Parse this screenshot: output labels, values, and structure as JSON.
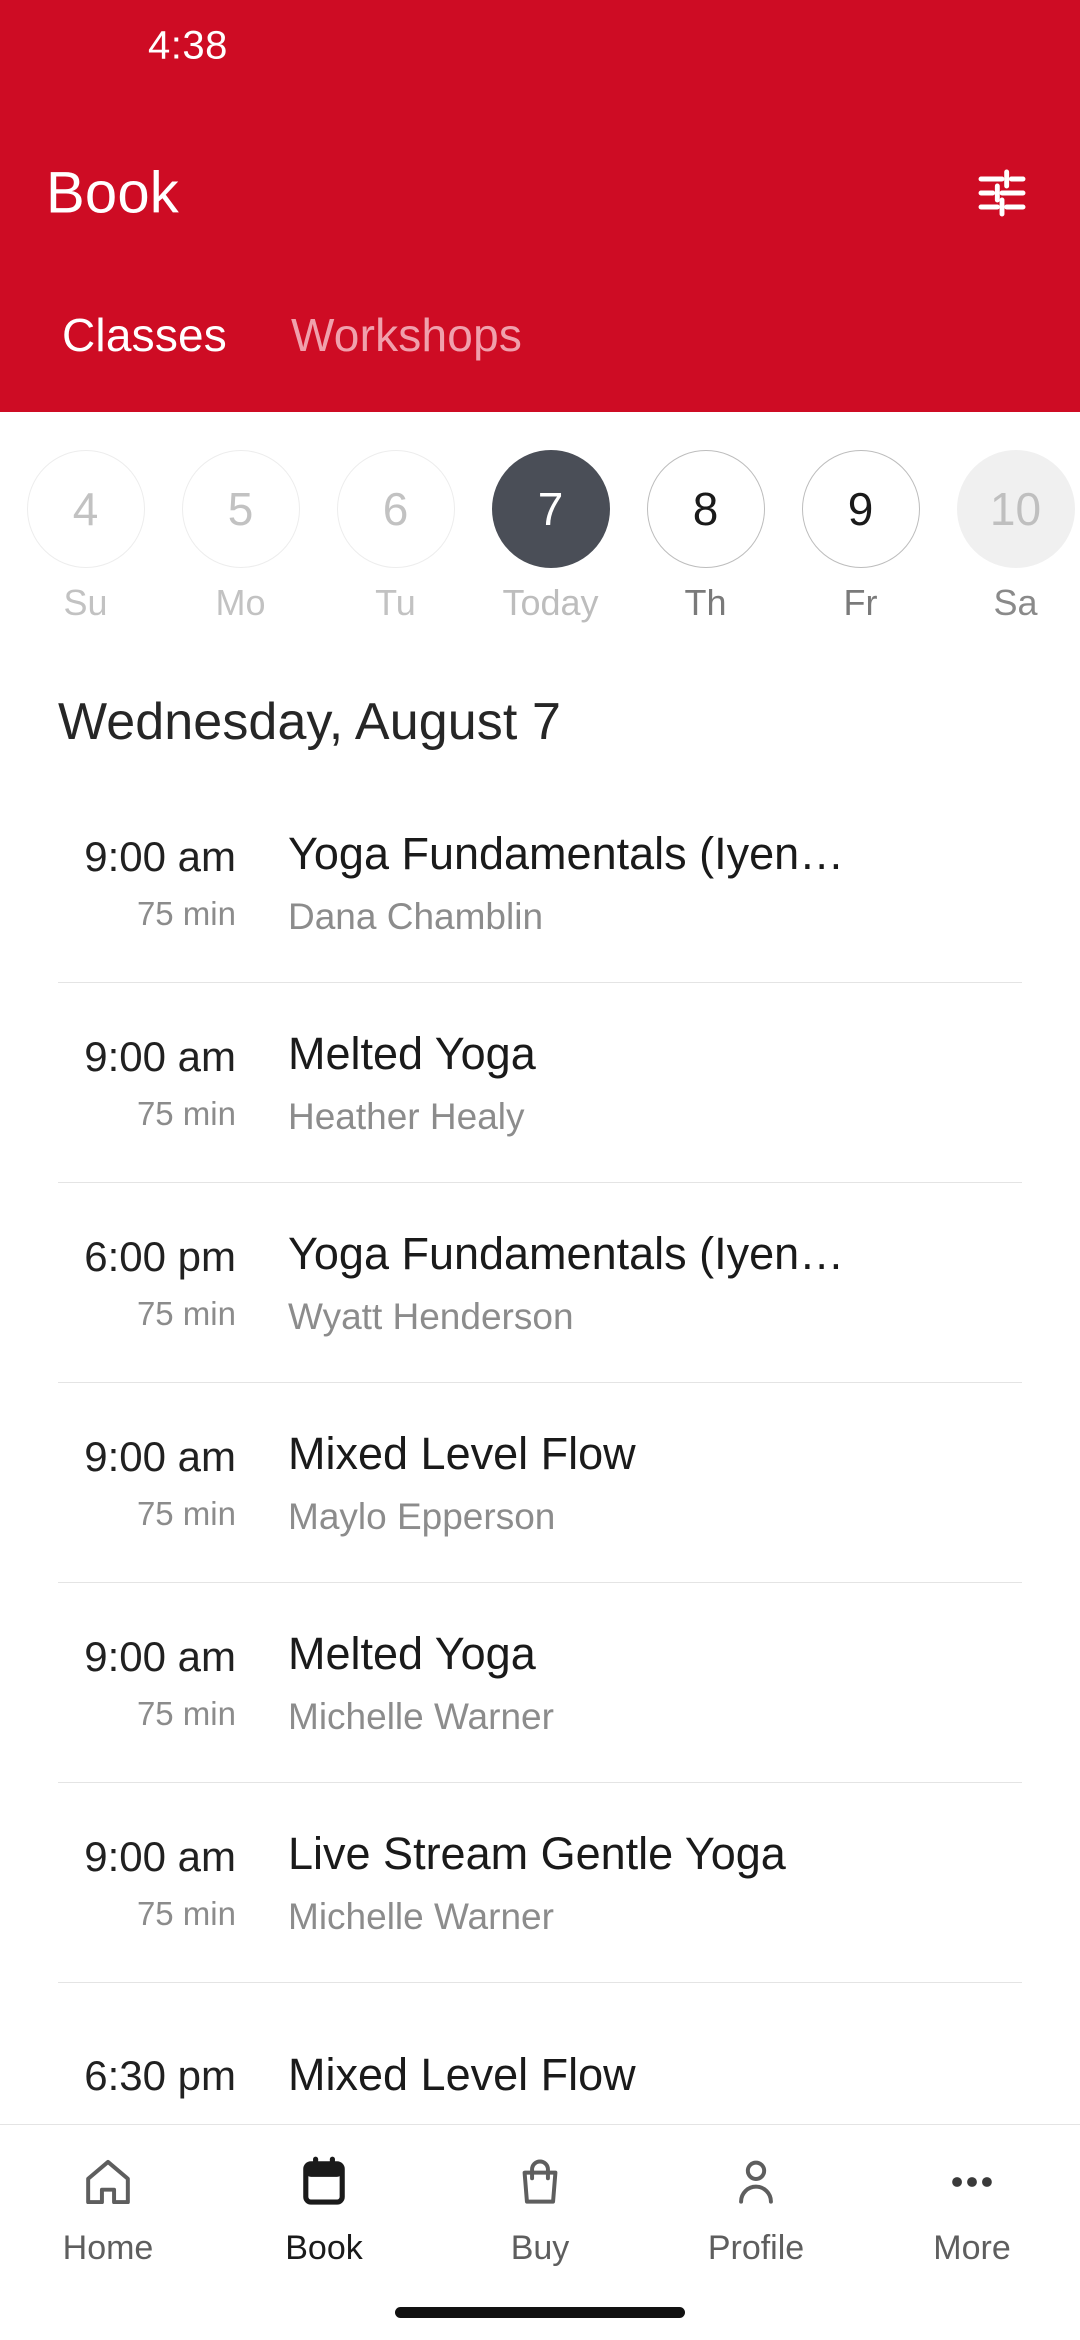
{
  "colors": {
    "brand_red": "#CE0C24",
    "selected_day": "#4A4E57",
    "muted_text": "#8C8C8C",
    "divider": "#E4E4E4"
  },
  "status_bar": {
    "time": "4:38"
  },
  "header": {
    "title": "Book",
    "filter_icon": "sliders-filter-icon",
    "tabs": [
      {
        "label": "Classes",
        "active": true
      },
      {
        "label": "Workshops",
        "active": false
      }
    ]
  },
  "date_strip": {
    "days": [
      {
        "num": "4",
        "weekday": "Su",
        "state": "past"
      },
      {
        "num": "5",
        "weekday": "Mo",
        "state": "past"
      },
      {
        "num": "6",
        "weekday": "Tu",
        "state": "past"
      },
      {
        "num": "7",
        "weekday": "Today",
        "state": "today"
      },
      {
        "num": "8",
        "weekday": "Th",
        "state": "future"
      },
      {
        "num": "9",
        "weekday": "Fr",
        "state": "future"
      },
      {
        "num": "10",
        "weekday": "Sa",
        "state": "dim"
      }
    ]
  },
  "date_heading": "Wednesday, August 7",
  "classes": [
    {
      "time": "9:00 am",
      "duration": "75 min",
      "title": "Yoga Fundamentals (Iyen…",
      "instructor": "Dana Chamblin"
    },
    {
      "time": "9:00 am",
      "duration": "75 min",
      "title": "Melted Yoga",
      "instructor": "Heather Healy"
    },
    {
      "time": "6:00 pm",
      "duration": "75 min",
      "title": "Yoga Fundamentals (Iyen…",
      "instructor": "Wyatt Henderson"
    },
    {
      "time": "9:00 am",
      "duration": "75 min",
      "title": "Mixed Level Flow",
      "instructor": "Maylo Epperson"
    },
    {
      "time": "9:00 am",
      "duration": "75 min",
      "title": "Melted Yoga",
      "instructor": "Michelle Warner"
    },
    {
      "time": "9:00 am",
      "duration": "75 min",
      "title": "Live Stream Gentle Yoga",
      "instructor": "Michelle Warner"
    },
    {
      "time": "6:30 pm",
      "duration": "",
      "title": "Mixed Level Flow",
      "instructor": ""
    }
  ],
  "bottom_nav": {
    "items": [
      {
        "label": "Home",
        "icon": "home-icon",
        "active": false
      },
      {
        "label": "Book",
        "icon": "calendar-icon",
        "active": true
      },
      {
        "label": "Buy",
        "icon": "shopping-bag-icon",
        "active": false
      },
      {
        "label": "Profile",
        "icon": "person-icon",
        "active": false
      },
      {
        "label": "More",
        "icon": "ellipsis-icon",
        "active": false
      }
    ]
  }
}
